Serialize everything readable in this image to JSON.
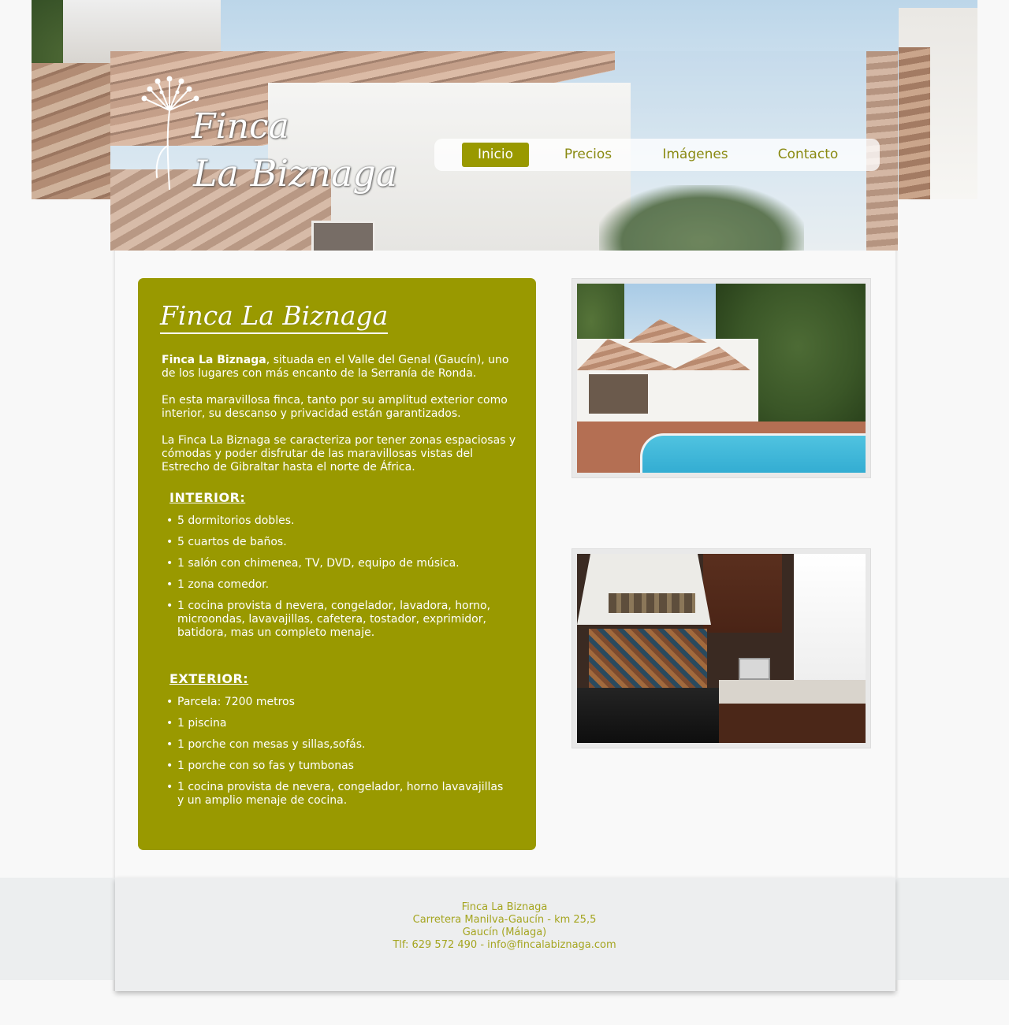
{
  "site": {
    "logo_line1": "Finca",
    "logo_line2": "La Biznaga"
  },
  "nav": {
    "items": [
      {
        "label": "Inicio",
        "active": true
      },
      {
        "label": "Precios",
        "active": false
      },
      {
        "label": "Imágenes",
        "active": false
      },
      {
        "label": "Contacto",
        "active": false
      }
    ]
  },
  "content": {
    "title": "Finca La Biznaga",
    "intro_bold": "Finca La Biznaga",
    "intro_p1_rest": ", situada en el Valle del Genal (Gaucín), uno de los lugares con más encanto de la Serranía de Ronda.",
    "intro_p2": "En esta maravillosa finca, tanto por su amplitud exterior como interior, su descanso y privacidad están garantizados.",
    "intro_p3": "La Finca La Biznaga se caracteriza por tener zonas espaciosas y cómodas y poder disfrutar de las maravillosas vistas del Estrecho de Gibraltar hasta el norte de África.",
    "interior": {
      "title": "INTERIOR:",
      "items": [
        "5 dormitorios dobles.",
        "5 cuartos de baños.",
        "1 salón con chimenea, TV, DVD, equipo de música.",
        "1 zona comedor.",
        "1 cocina provista d nevera, congelador, lavadora, horno, microondas, lavavajillas, cafetera, tostador, exprimidor, batidora, mas un completo menaje."
      ]
    },
    "exterior": {
      "title": "EXTERIOR:",
      "items": [
        "Parcela: 7200 metros",
        "1 piscina",
        "1 porche con mesas y sillas,sofás.",
        "1 porche con so fas y tumbonas",
        "1 cocina provista de nevera, congelador, horno lavavajillas y un amplio menaje de cocina."
      ]
    }
  },
  "photos": [
    {
      "subject": "pool-house"
    },
    {
      "subject": "kitchen"
    }
  ],
  "footer": {
    "line1": "Finca La Biznaga",
    "line2": "Carretera Manilva-Gaucín - km 25,5",
    "line3": "Gaucín (Málaga)",
    "line4": "Tlf: 629 572 490 - info@fincalabiznaga.com"
  },
  "colors": {
    "accent": "#999900",
    "footer_text": "#a5a520",
    "page_bg": "#f8f8f8",
    "footer_bg": "#eceeef"
  }
}
